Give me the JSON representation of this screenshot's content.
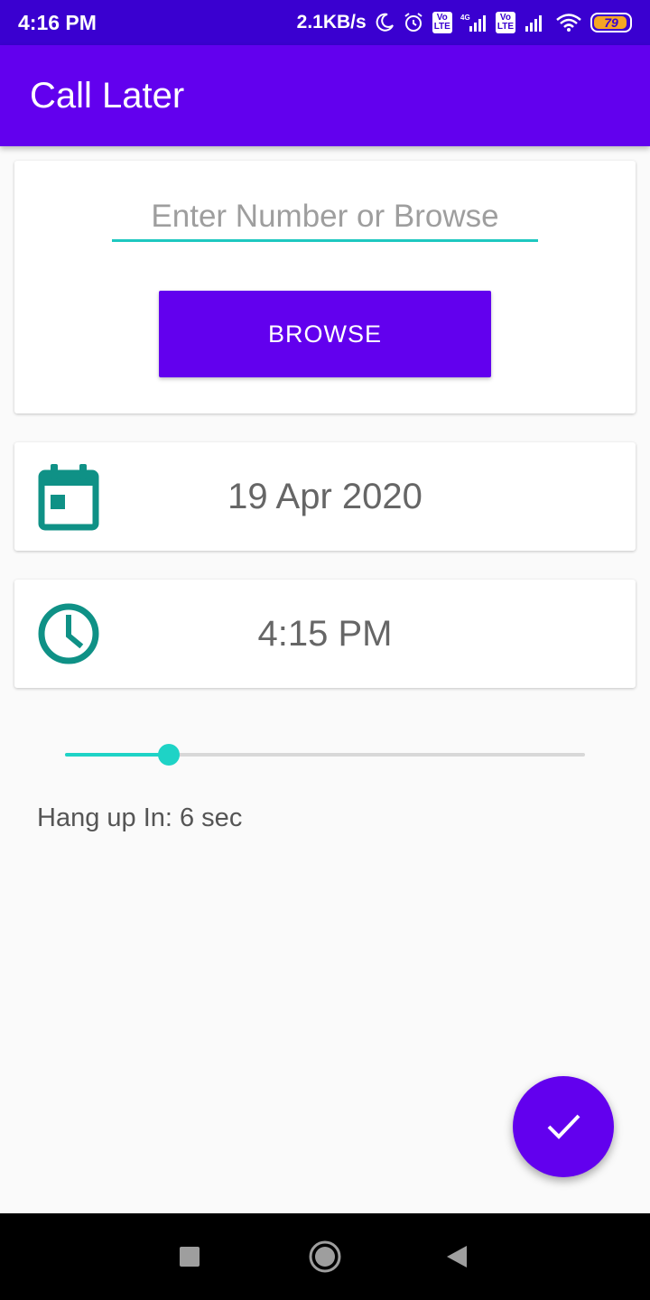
{
  "status_bar": {
    "time": "4:16 PM",
    "net_speed": "2.1KB/s",
    "network_label": "4G",
    "lte_label": "Vo\nLTE",
    "battery": "79",
    "icons": [
      "moon-icon",
      "alarm-icon",
      "volte-icon",
      "signal-icon",
      "volte-icon",
      "signal-icon",
      "wifi-icon",
      "battery-icon"
    ]
  },
  "app_bar": {
    "title": "Call Later"
  },
  "number_card": {
    "input_value": "",
    "input_placeholder": "Enter Number or Browse",
    "browse_label": "BROWSE"
  },
  "date_card": {
    "icon": "calendar-icon",
    "value": "19 Apr 2020"
  },
  "time_card": {
    "icon": "clock-icon",
    "value": "4:15 PM"
  },
  "slider": {
    "fraction": 0.2,
    "track_color": "#d8d8d8",
    "active_color": "#1ed3c6"
  },
  "hangup": {
    "text": "Hang up In: 6 sec"
  },
  "fab": {
    "icon": "check-icon"
  },
  "nav_bar": {
    "icons": [
      "recents-square-icon",
      "home-circle-icon",
      "back-triangle-icon"
    ]
  },
  "colors": {
    "primary": "#6200ee",
    "primary_dark": "#3a00d0",
    "accent": "#1ed3c6",
    "icon_teal": "#0f9186"
  }
}
